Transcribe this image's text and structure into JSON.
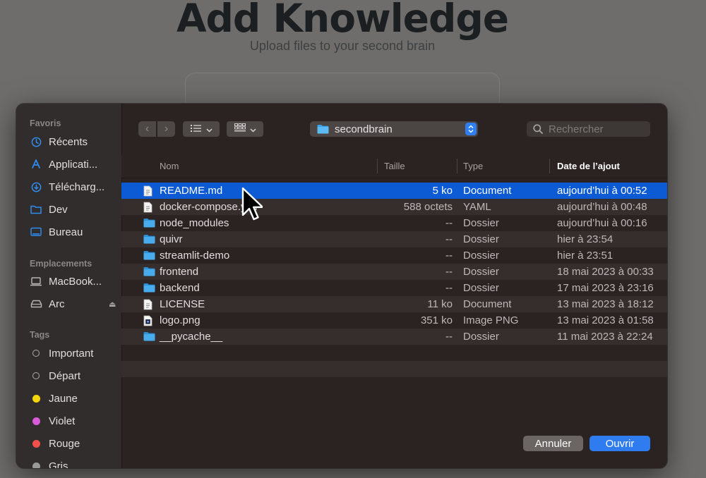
{
  "background": {
    "title": "Add Knowledge",
    "subtitle": "Upload files to your second brain"
  },
  "sidebar": {
    "favorites_heading": "Favoris",
    "favorites": [
      {
        "label": "Récents",
        "icon": "clock-icon"
      },
      {
        "label": "Applicati...",
        "icon": "applications-icon"
      },
      {
        "label": "Télécharg...",
        "icon": "download-icon"
      },
      {
        "label": "Dev",
        "icon": "folder-icon"
      },
      {
        "label": "Bureau",
        "icon": "desktop-icon"
      }
    ],
    "locations_heading": "Emplacements",
    "locations": [
      {
        "label": "MacBook...",
        "icon": "laptop-icon"
      },
      {
        "label": "Arc",
        "icon": "drive-icon"
      }
    ],
    "tags_heading": "Tags",
    "tags": [
      {
        "label": "Important",
        "color": "empty"
      },
      {
        "label": "Départ",
        "color": "empty"
      },
      {
        "label": "Jaune",
        "color": "#f5d60a"
      },
      {
        "label": "Violet",
        "color": "#d95ad8"
      },
      {
        "label": "Rouge",
        "color": "#f2504a"
      },
      {
        "label": "Gris",
        "color": "#9a9a9a"
      }
    ]
  },
  "toolbar": {
    "back_glyph": "‹",
    "forward_glyph": "›",
    "current_folder": "secondbrain",
    "search_placeholder": "Rechercher"
  },
  "columns": {
    "name": "Nom",
    "size": "Taille",
    "type": "Type",
    "date": "Date de l’ajout"
  },
  "files": [
    {
      "name": "README.md",
      "size": "5 ko",
      "type": "Document",
      "date": "aujourd’hui à 00:52",
      "kind": "doc",
      "selected": true
    },
    {
      "name": "docker-compose.yml",
      "size": "588 octets",
      "type": "YAML",
      "date": "aujourd’hui à 00:48",
      "kind": "doc",
      "selected": false
    },
    {
      "name": "node_modules",
      "size": "--",
      "type": "Dossier",
      "date": "aujourd’hui à 00:16",
      "kind": "folder",
      "selected": false
    },
    {
      "name": "quivr",
      "size": "--",
      "type": "Dossier",
      "date": "hier à 23:54",
      "kind": "folder",
      "selected": false
    },
    {
      "name": "streamlit-demo",
      "size": "--",
      "type": "Dossier",
      "date": "hier à 23:51",
      "kind": "folder",
      "selected": false
    },
    {
      "name": "frontend",
      "size": "--",
      "type": "Dossier",
      "date": "18 mai 2023 à 00:33",
      "kind": "folder",
      "selected": false
    },
    {
      "name": "backend",
      "size": "--",
      "type": "Dossier",
      "date": "17 mai 2023 à 23:16",
      "kind": "folder",
      "selected": false
    },
    {
      "name": "LICENSE",
      "size": "11 ko",
      "type": "Document",
      "date": "13 mai 2023 à 18:12",
      "kind": "doc",
      "selected": false
    },
    {
      "name": "logo.png",
      "size": "351 ko",
      "type": "Image PNG",
      "date": "13 mai 2023 à 01:58",
      "kind": "image",
      "selected": false
    },
    {
      "name": "__pycache__",
      "size": "--",
      "type": "Dossier",
      "date": "11 mai 2023 à 22:24",
      "kind": "folder",
      "selected": false
    }
  ],
  "buttons": {
    "cancel": "Annuler",
    "open": "Ouvrir"
  },
  "colors": {
    "accent": "#2f7bf0",
    "selection": "#0d5bd4",
    "folder": "#3aa5ea"
  }
}
